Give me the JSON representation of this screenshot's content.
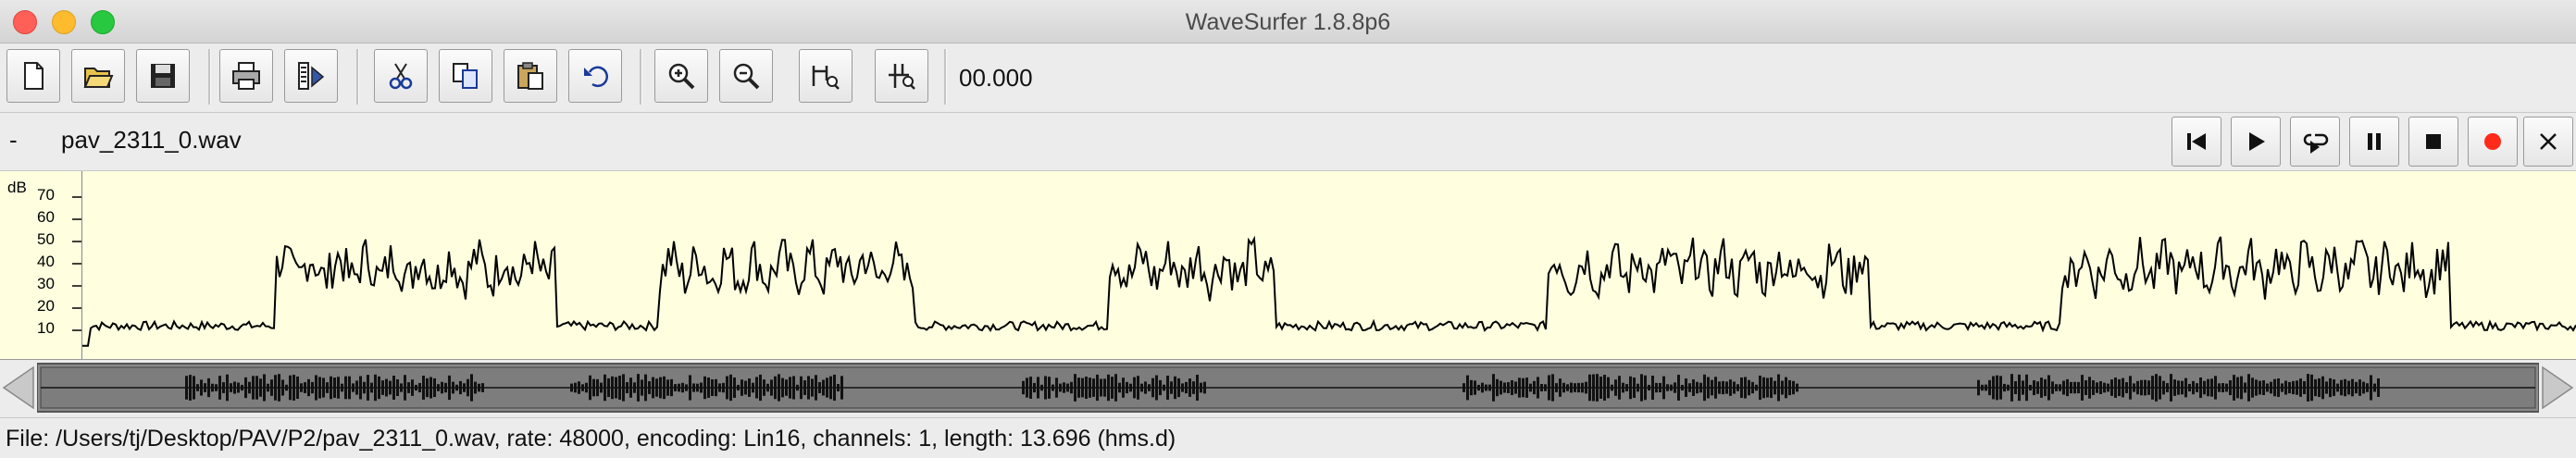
{
  "window": {
    "title": "WaveSurfer 1.8.8p6",
    "controls": [
      {
        "name": "close",
        "color": "#fe5f57"
      },
      {
        "name": "minimize",
        "color": "#febb2e"
      },
      {
        "name": "maximize",
        "color": "#28c840"
      }
    ]
  },
  "toolbar": {
    "buttons": [
      "new-file-icon",
      "open-folder-icon",
      "save-icon",
      "print-icon",
      "properties-icon",
      "cut-icon",
      "copy-icon",
      "paste-icon",
      "undo-icon",
      "zoom-in-icon",
      "zoom-out-icon",
      "zoom-to-selection-icon",
      "zoom-fit-icon"
    ],
    "time": "00.000"
  },
  "filebar": {
    "dash": "-",
    "filename": "pav_2311_0.wav",
    "playback_buttons": [
      "skip-to-start-icon",
      "play-icon",
      "play-loop-icon",
      "pause-icon",
      "stop-icon",
      "record-icon",
      "close-icon"
    ]
  },
  "plot": {
    "unit": "dB",
    "ticks": [
      "70",
      "60",
      "50",
      "40",
      "30",
      "20",
      "10"
    ],
    "background": "#ffffe0",
    "line_color": "#000000"
  },
  "status": {
    "text": "File: /Users/tj/Desktop/PAV/P2/pav_2311_0.wav, rate: 48000, encoding: Lin16, channels: 1, length: 13.696 (hms.d)"
  }
}
